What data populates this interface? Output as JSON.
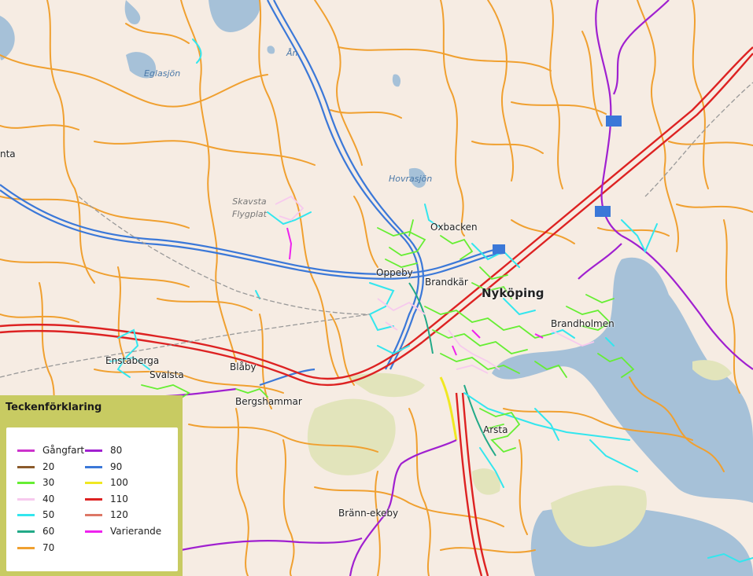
{
  "places": {
    "oxbacken": "Oxbacken",
    "oppeby": "Oppeby",
    "brandkar": "Brandkär",
    "nykoping": "Nyköping",
    "brandholmen": "Brandholmen",
    "bergshammar": "Bergshammar",
    "enstaberga": "Enstaberga",
    "svalsta": "Svalsta",
    "blaby": "Blåby",
    "branneekeby": "Bränn-ekeby",
    "arsta": "Arsta",
    "jonaker": "nta"
  },
  "water": {
    "eglasjon": "Eglasjön",
    "hovrasjon": "Hovrasjön",
    "lan": "Ån"
  },
  "airport": {
    "line1": "Skavsta",
    "line2": "Flygplat"
  },
  "legend": {
    "title": "Teckenförklaring",
    "items": [
      {
        "label": "Gångfart",
        "color": "#cc33cc"
      },
      {
        "label": "20",
        "color": "#8b5a2b"
      },
      {
        "label": "30",
        "color": "#66ee33"
      },
      {
        "label": "40",
        "color": "#f7c9ee"
      },
      {
        "label": "50",
        "color": "#33e6ee"
      },
      {
        "label": "60",
        "color": "#22aa88"
      },
      {
        "label": "70",
        "color": "#f0a030"
      },
      {
        "label": "80",
        "color": "#a020d0"
      },
      {
        "label": "90",
        "color": "#3b78d8"
      },
      {
        "label": "100",
        "color": "#f0e822"
      },
      {
        "label": "110",
        "color": "#dd2222"
      },
      {
        "label": "120",
        "color": "#dd7766"
      },
      {
        "label": "Varierande",
        "color": "#ee22ee"
      }
    ]
  },
  "colors": {
    "land": "#f6ece3",
    "water": "#a6c1d8",
    "forest": "#e2e4bb"
  }
}
